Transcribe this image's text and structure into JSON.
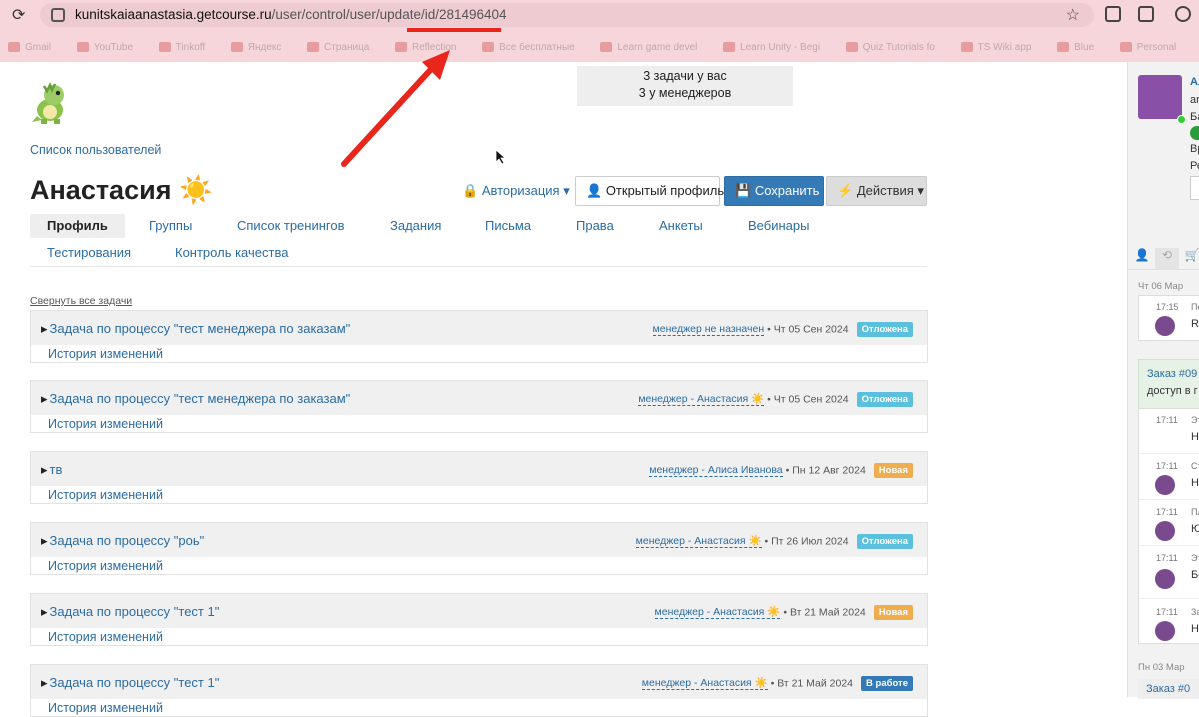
{
  "browser": {
    "url_host": "kunitskaiaanastasia.getcourse.ru",
    "url_path": "/user/control/user/update/id/281496404",
    "bookmarks": [
      "Gmail",
      "YouTube",
      "Tinkoff",
      "Яндекс",
      "Страница",
      "Reflection",
      "Все бесплатные",
      "Learn game devel",
      "Learn Unity - Begi",
      "Quiz Tutorials fo",
      "TS Wiki app",
      "Blue",
      "Personal"
    ]
  },
  "task_summary": {
    "line1": "3 задачи у вас",
    "line2": "3 у менеджеров"
  },
  "nav": {
    "users_link": "Список пользователей"
  },
  "user": {
    "name": "Анастасия",
    "emoji": "☀️"
  },
  "toolbar": {
    "auth_label": "Авторизация",
    "profile_label": "Открытый профиль",
    "save_label": "Сохранить",
    "actions_label": "Действия"
  },
  "tabs": [
    {
      "label": "Профиль"
    },
    {
      "label": "Группы"
    },
    {
      "label": "Список тренингов"
    },
    {
      "label": "Задания"
    },
    {
      "label": "Письма"
    },
    {
      "label": "Права"
    },
    {
      "label": "Анкеты"
    },
    {
      "label": "Вебинары"
    },
    {
      "label": "Тестирования"
    },
    {
      "label": "Контроль качества"
    }
  ],
  "collapse_label": "Свернуть все задачи",
  "history_label": "История изменений",
  "tasks": [
    {
      "title": "Задача по процессу \"тест менеджера по заказам\"",
      "manager": "менеджер не назначен",
      "date": "Чт 05 Сен 2024",
      "status": "Отложена",
      "status_color": "#5bc0de"
    },
    {
      "title": "Задача по процессу \"тест менеджера по заказам\"",
      "manager": "менеджер - Анастасия ☀️",
      "date": "Чт 05 Сен 2024",
      "status": "Отложена",
      "status_color": "#5bc0de"
    },
    {
      "title": "тв",
      "manager": "менеджер - Алиса Иванова",
      "date": "Пн 12 Авг 2024",
      "status": "Новая",
      "status_color": "#f0ad4e"
    },
    {
      "title": "Задача по процессу \"роь\"",
      "manager": "менеджер - Анастасия ☀️",
      "date": "Пт 26 Июл 2024",
      "status": "Отложена",
      "status_color": "#5bc0de"
    },
    {
      "title": "Задача по процессу \"тест 1\"",
      "manager": "менеджер - Анастасия ☀️",
      "date": "Вт 21 Май 2024",
      "status": "Новая",
      "status_color": "#f0ad4e"
    },
    {
      "title": "Задача по процессу \"тест 1\"",
      "manager": "менеджер - Анастасия ☀️",
      "date": "Вт 21 Май 2024",
      "status": "В работе",
      "status_color": "#337ab7"
    }
  ],
  "right_panel": {
    "name_fragment": "Ал",
    "lines": [
      "ar",
      "Ба",
      "Вр",
      "Ре"
    ],
    "date1": "Чт 06 Мар",
    "date2": "Пн 03 Мар",
    "items": [
      {
        "time": "17:15",
        "t1": "Пе",
        "t2": "Re"
      },
      {
        "time": "17:11",
        "t1": "Эт",
        "t2": "Не"
      },
      {
        "time": "17:11",
        "t1": "Ст",
        "t2": "Не"
      },
      {
        "time": "17:11",
        "t1": "Пл",
        "t2": "Ю"
      },
      {
        "time": "17:11",
        "t1": "Эт",
        "t2": "Бе"
      },
      {
        "time": "17:11",
        "t1": "За",
        "t2": "Не"
      }
    ],
    "green_line1": "Заказ #09",
    "green_line2": "доступ в г",
    "bottom_link": "Заказ #0"
  }
}
